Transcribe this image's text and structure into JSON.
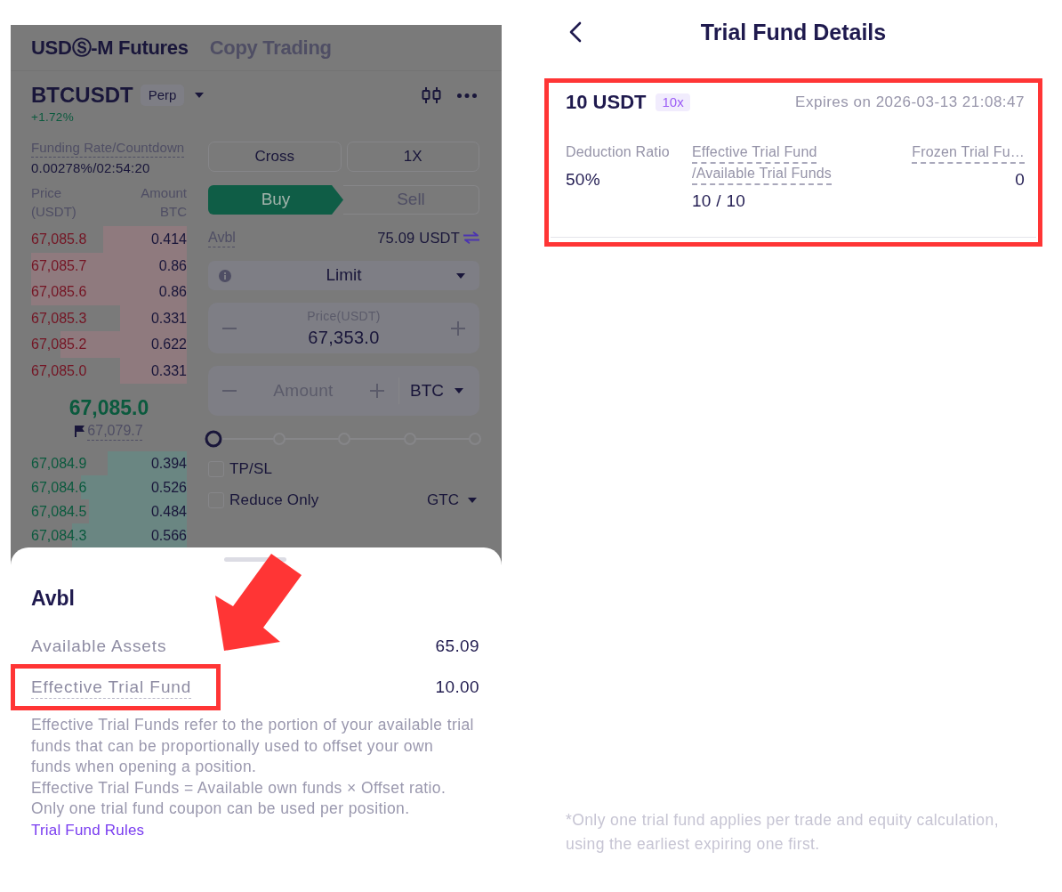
{
  "trading_screen": {
    "dimmed": true,
    "tabs": [
      {
        "label": "USDⓈ-M Futures",
        "selected": true
      },
      {
        "label": "Copy Trading",
        "selected": false
      }
    ],
    "symbol": "BTCUSDT",
    "contract_badge": "Perp",
    "change": "+1.72%",
    "funding": {
      "label": "Funding Rate/Countdown",
      "value": "0.00278%/02:54:20"
    },
    "order_book": {
      "price_header": "Price",
      "price_unit": "(USDT)",
      "amount_header": "Amount",
      "amount_unit": "BTC",
      "asks": [
        {
          "price": "67,085.8",
          "amount": "0.414",
          "level": 0.54
        },
        {
          "price": "67,085.7",
          "amount": "0.86",
          "level": 1
        },
        {
          "price": "67,085.6",
          "amount": "0.86",
          "level": 1
        },
        {
          "price": "67,085.3",
          "amount": "0.331",
          "level": 0.43
        },
        {
          "price": "67,085.2",
          "amount": "0.622",
          "level": 0.81
        },
        {
          "price": "67,085.0",
          "amount": "0.331",
          "level": 0.43
        }
      ],
      "last_price": "67,085.0",
      "mark_price": "67,079.7",
      "bids": [
        {
          "price": "67,084.9",
          "amount": "0.394",
          "level": 0.51
        },
        {
          "price": "67,084.6",
          "amount": "0.526",
          "level": 0.68
        },
        {
          "price": "67,084.5",
          "amount": "0.484",
          "level": 0.63
        },
        {
          "price": "67,084.3",
          "amount": "0.566",
          "level": 0.74
        }
      ]
    },
    "order_form": {
      "margin_mode": "Cross",
      "leverage": "1X",
      "sides": [
        {
          "label": "Buy",
          "kind": "buy",
          "selected": true
        },
        {
          "label": "Sell",
          "kind": "sell",
          "selected": false
        }
      ],
      "available_label": "Avbl",
      "available_value": "75.09 USDT",
      "order_type": "Limit",
      "price_field": {
        "label": "Price(USDT)",
        "value": "67,353.0"
      },
      "amount_field": {
        "placeholder": "Amount",
        "unit": "BTC"
      },
      "size_slider": {
        "level": 0
      },
      "options": [
        {
          "label": "TP/SL",
          "checked": false
        },
        {
          "label": "Reduce Only",
          "checked": false
        }
      ],
      "time_in_force": "GTC"
    }
  },
  "bottom_sheet": {
    "title": "Avbl",
    "pointer_arrow": true,
    "rows": [
      {
        "label": "Available Assets",
        "value": "65.09",
        "underlined": false,
        "highlighted": false
      },
      {
        "label": "Effective Trial Fund",
        "value": "10.00",
        "underlined": true,
        "highlighted": true
      }
    ],
    "description": [
      "Effective Trial Funds refer to the portion of your available trial funds that can be proportionally used to offset your own funds when opening a position.",
      "Effective Trial Funds = Available own funds × Offset ratio.",
      "Only one trial fund coupon can be used per position."
    ],
    "link": "Trial Fund Rules"
  },
  "details_page": {
    "title": "Trial Fund Details",
    "card": {
      "highlighted": true,
      "amount": "10 USDT",
      "multiplier": "10x",
      "expiry": "Expires on 2026-03-13 21:08:47",
      "stats": [
        {
          "label": "Deduction Ratio",
          "value": "50%",
          "underlined": false
        },
        {
          "label": "Effective Trial Fund /Available Trial Funds",
          "value": "10 / 10",
          "underlined": true
        },
        {
          "label": "Frozen Trial Fu…",
          "value": "0",
          "underlined": true
        }
      ]
    },
    "footnote": "*Only one trial fund applies per trade and equity calculation, using the earliest expiring one first."
  }
}
